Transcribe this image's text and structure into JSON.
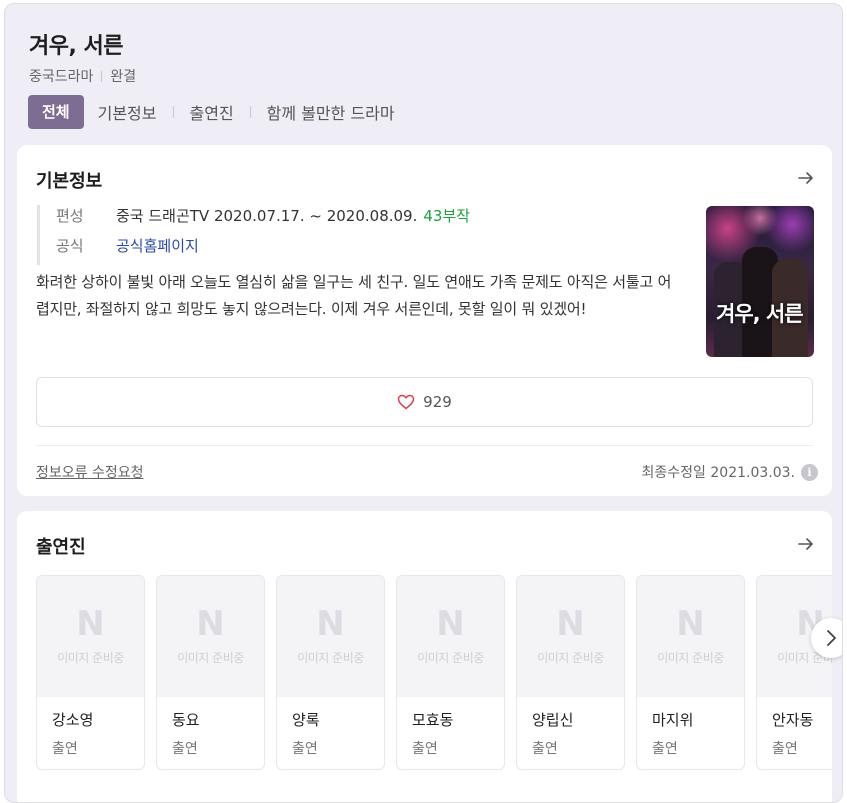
{
  "header": {
    "title": "겨우, 서른",
    "genre": "중국드라마",
    "status": "완결"
  },
  "tabs": [
    {
      "label": "전체",
      "active": true
    },
    {
      "label": "기본정보"
    },
    {
      "label": "출연진"
    },
    {
      "label": "함께 볼만한 드라마"
    }
  ],
  "basic_info": {
    "section_title": "기본정보",
    "broadcast_label": "편성",
    "broadcast_value": "중국 드래곤TV  2020.07.17. ~ 2020.08.09.",
    "episodes": "43부작",
    "official_label": "공식",
    "official_link": "공식홈페이지",
    "synopsis": "화려한 상하이 불빛 아래 오늘도 열심히 삶을 일구는 세 친구. 일도 연애도 가족 문제도 아직은 서툴고 어렵지만, 좌절하지 않고 희망도 놓지 않으려는다. 이제 겨우 서른인데, 못할 일이 뭐 있겠어!",
    "poster_text": "겨우, 서른",
    "likes": "929",
    "report_link": "정보오류 수정요청",
    "updated": "최종수정일 2021.03.03.",
    "info_icon": "i"
  },
  "cast": {
    "section_title": "출연진",
    "placeholder_logo": "N",
    "placeholder_text": "이미지 준비중",
    "members": [
      {
        "name": "강소영",
        "role": "출연"
      },
      {
        "name": "동요",
        "role": "출연"
      },
      {
        "name": "양록",
        "role": "출연"
      },
      {
        "name": "모효동",
        "role": "출연"
      },
      {
        "name": "양립신",
        "role": "출연"
      },
      {
        "name": "마지위",
        "role": "출연"
      },
      {
        "name": "안자동",
        "role": "출연"
      }
    ]
  },
  "colors": {
    "accent": "#7e6d93",
    "episodes_green": "#19a33c",
    "link_blue": "#2b4aa8",
    "heart": "#e0424b"
  }
}
